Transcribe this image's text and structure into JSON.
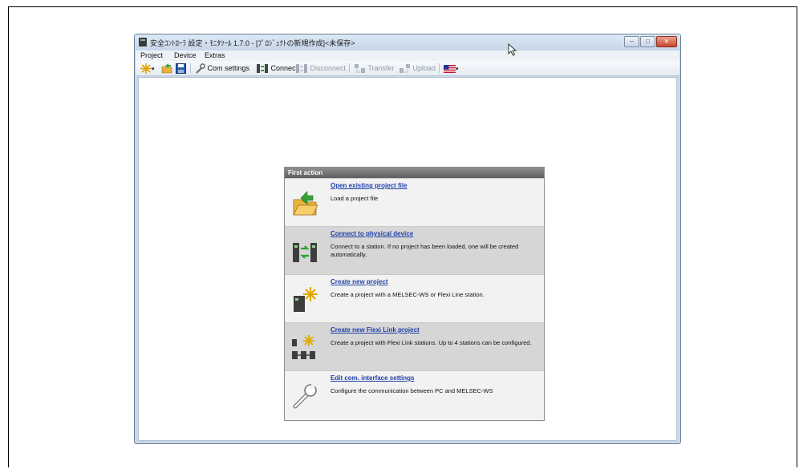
{
  "window": {
    "title": "安全ｺﾝﾄﾛｰﾗ 設定・ﾓﾆﾀﾂｰﾙ 1.7.0 - [ﾌﾟﾛｼﾞｪｸﾄの新規作成]<未保存>",
    "buttons": {
      "minimize": "–",
      "maximize": "□",
      "close": "✕"
    }
  },
  "menu": {
    "project": "Project",
    "device": "Device",
    "extras": "Extras"
  },
  "toolbar": {
    "com_settings": "Com settings",
    "connect": "Connect",
    "disconnect": "Disconnect",
    "transfer": "Transfer",
    "upload": "Upload"
  },
  "panel": {
    "header": "First action",
    "actions": [
      {
        "title": "Open existing project file",
        "desc": "Load a project file",
        "icon": "open-folder-icon"
      },
      {
        "title": "Connect to physical device",
        "desc": "Connect to a station.  If no project has been loaded, one will be created automatically.",
        "icon": "device-connect-icon"
      },
      {
        "title": "Create new project",
        "desc": "Create a project with a MELSEC-WS or Flexi Line station.",
        "icon": "new-project-icon"
      },
      {
        "title": "Create new Flexi Link project",
        "desc": "Create a project with Flexi Link stations. Up to 4 stations can be configured.",
        "icon": "flexi-link-icon"
      },
      {
        "title": "Edit com. interface settings",
        "desc": "Configure the communication between PC and MELSEC-WS",
        "icon": "wrench-icon"
      }
    ]
  },
  "colors": {
    "link": "#1f3fa8",
    "panel_header": "#6e6e6e",
    "row_light": "#f2f2f2",
    "row_dark": "#d6d6d6"
  }
}
